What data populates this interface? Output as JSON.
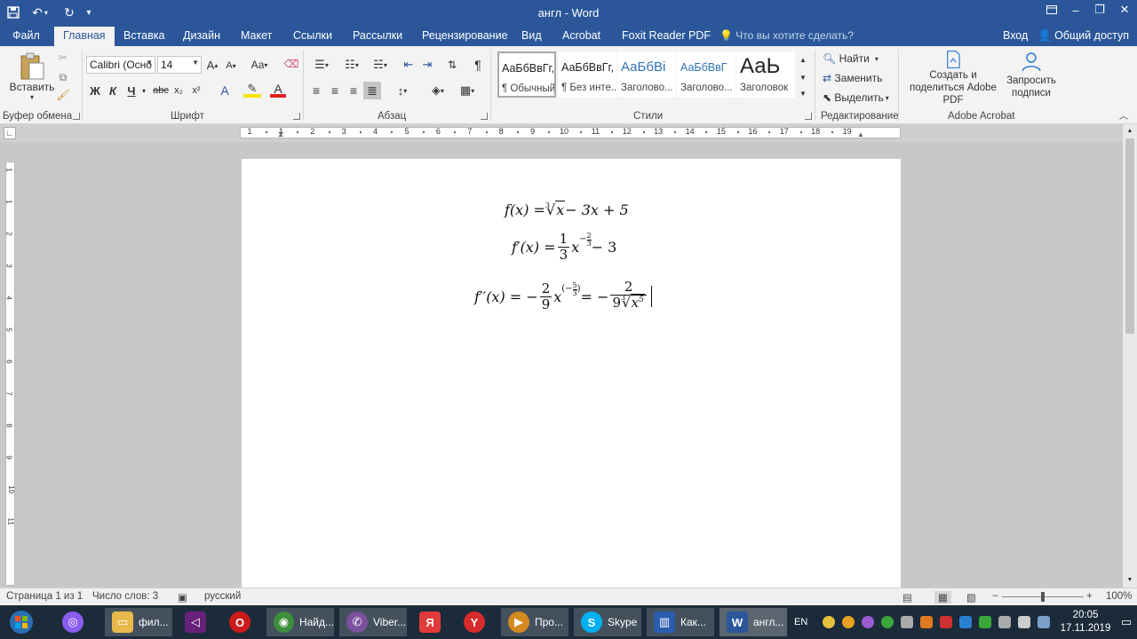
{
  "window": {
    "title": "англ - Word",
    "qa_icons": [
      "save-icon",
      "undo-icon",
      "redo-icon",
      "customize-icon"
    ]
  },
  "tabs": {
    "file": "Файл",
    "home": "Главная",
    "insert": "Вставка",
    "design": "Дизайн",
    "layout": "Макет",
    "references": "Ссылки",
    "mailings": "Рассылки",
    "review": "Рецензирование",
    "view": "Вид",
    "acrobat": "Acrobat",
    "foxit": "Foxit Reader PDF",
    "tellme": "Что вы хотите сделать?",
    "signin": "Вход",
    "share": "Общий доступ"
  },
  "ribbon": {
    "clipboard": {
      "paste": "Вставить",
      "label": "Буфер обмена"
    },
    "font": {
      "name": "Calibri (Осно",
      "size": "14",
      "bold": "Ж",
      "italic": "К",
      "underline": "Ч",
      "case": "Аа",
      "label": "Шрифт"
    },
    "paragraph": {
      "label": "Абзац"
    },
    "styles": {
      "items": [
        {
          "sample": "АаБбВвГг,",
          "name": "¶ Обычный"
        },
        {
          "sample": "АаБбВвГг,",
          "name": "¶ Без инте..."
        },
        {
          "sample": "АаБбВі",
          "name": "Заголово..."
        },
        {
          "sample": "АаБбВвГ",
          "name": "Заголово..."
        },
        {
          "sample": "АаЬ",
          "name": "Заголовок"
        }
      ],
      "label": "Стили"
    },
    "editing": {
      "find": "Найти",
      "replace": "Заменить",
      "select": "Выделить",
      "label": "Редактирование"
    },
    "acrobat": {
      "create": "Создать и поделиться Adobe PDF",
      "request": "Запросить подписи",
      "label": "Adobe Acrobat"
    }
  },
  "ruler": {
    "h_ticks": [
      "1",
      "1",
      "2",
      "3",
      "4",
      "5",
      "6",
      "7",
      "8",
      "9",
      "10",
      "11",
      "12",
      "13",
      "14",
      "15",
      "16",
      "17",
      "18",
      "19"
    ],
    "v_ticks": [
      "1",
      "1",
      "2",
      "3",
      "4",
      "5",
      "6",
      "7",
      "8",
      "9",
      "10",
      "11"
    ]
  },
  "document": {
    "eq1": {
      "lhs": "f(x) = ",
      "index": "3",
      "rad": "x",
      "rest": " − 3x + 5"
    },
    "eq2": {
      "lhs": "f′(x) = ",
      "num": "1",
      "den": "3",
      "var": "x",
      "exp_sign": "−",
      "exp_num": "2",
      "exp_den": "3",
      "rest": " − 3"
    },
    "eq3": {
      "lhs": "f′′(x) = −",
      "num": "2",
      "den": "9",
      "var": "x",
      "exp_open": "(−",
      "exp_num": "5",
      "exp_den": "3",
      "exp_close": ")",
      "mid": " = −",
      "num2": "2",
      "den2_coef": "9",
      "den2_index": "3",
      "den2_rad": "x",
      "den2_exp": "5"
    }
  },
  "status": {
    "page": "Страница 1 из 1",
    "words": "Число слов: 3",
    "lang": "русский",
    "zoom": "100%"
  },
  "taskbar": {
    "items": [
      "фил...",
      "Найд...",
      "Viber...",
      "Про...",
      "Skype",
      "Как...",
      "англ..."
    ],
    "lang": "EN",
    "time": "20:05",
    "date": "17.11.2019"
  },
  "colors": {
    "accent": "#2b579a",
    "taskbar": "#1c2b3a"
  }
}
